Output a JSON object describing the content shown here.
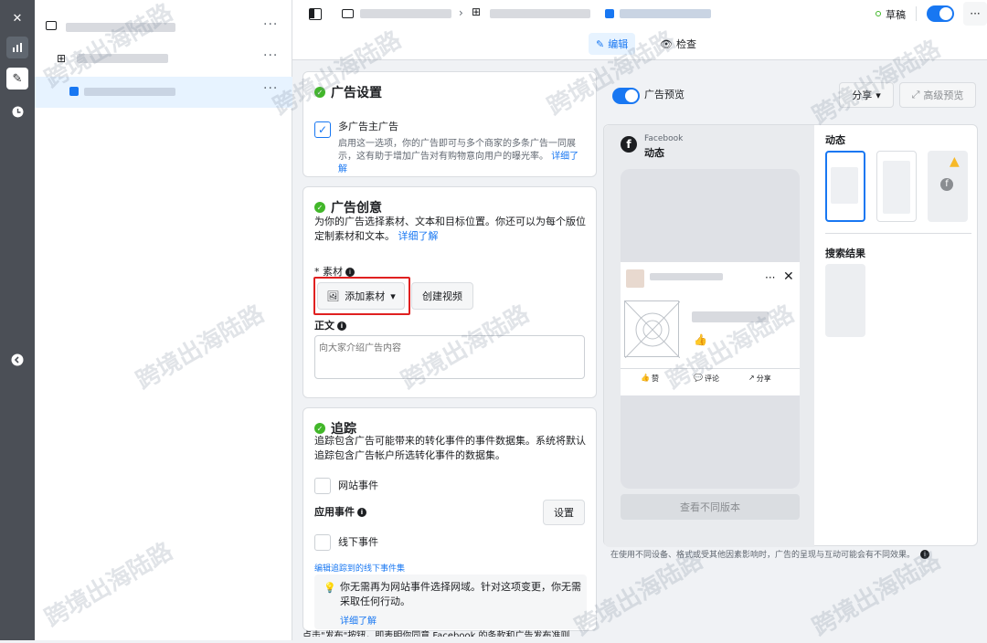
{
  "topbar": {
    "status_label": "草稿",
    "more": "···",
    "tab_edit": "编辑",
    "tab_review": "检查"
  },
  "tree": {
    "more": "···"
  },
  "ad_settings": {
    "title": "广告设置",
    "multi_advertiser_label": "多广告主广告",
    "multi_advertiser_desc": "启用这一选项，你的广告即可与多个商家的多条广告一同展示，这有助于增加广告对有购物意向用户的曝光率。",
    "learn_more": "详细了解"
  },
  "creative": {
    "title": "广告创意",
    "desc": "为你的广告选择素材、文本和目标位置。你还可以为每个版位定制素材和文本。",
    "learn_more": "详细了解",
    "media_label": "* 素材",
    "add_media": "添加素材",
    "create_video": "创建视频",
    "primary_text_label": "正文",
    "primary_text_placeholder": "向大家介绍广告内容"
  },
  "tracking": {
    "title": "追踪",
    "desc": "追踪包含广告可能带来的转化事件的事件数据集。系统将默认追踪包含广告帐户所选转化事件的数据集。",
    "website_events": "网站事件",
    "app_events": "应用事件",
    "setup_button": "设置",
    "offline_events": "线下事件",
    "edit_offline_link": "编辑追踪到的线下事件集",
    "tip": "你无需再为网站事件选择网域。针对这项变更，你无需采取任何行动。",
    "tip_link": "详细了解"
  },
  "footer_text": "点击\"发布\"按钮，即表明你同意 Facebook 的条款和广告发布准则",
  "preview": {
    "toggle_label": "广告预览",
    "share": "分享",
    "advanced_preview": "高级预览",
    "platform": "Facebook",
    "placement": "动态",
    "like": "赞",
    "comment": "评论",
    "share_action": "分享",
    "see_variations": "查看不同版本",
    "feeds_heading": "动态",
    "search_heading": "搜索结果",
    "disclaimer": "在使用不同设备、格式或受其他因素影响时，广告的呈现与互动可能会有不同效果。"
  },
  "watermark": "跨境出海陆路",
  "colors": {
    "accent": "#1877f2",
    "success": "#42b72a",
    "warning": "#f7b928",
    "highlight": "#e02020"
  }
}
